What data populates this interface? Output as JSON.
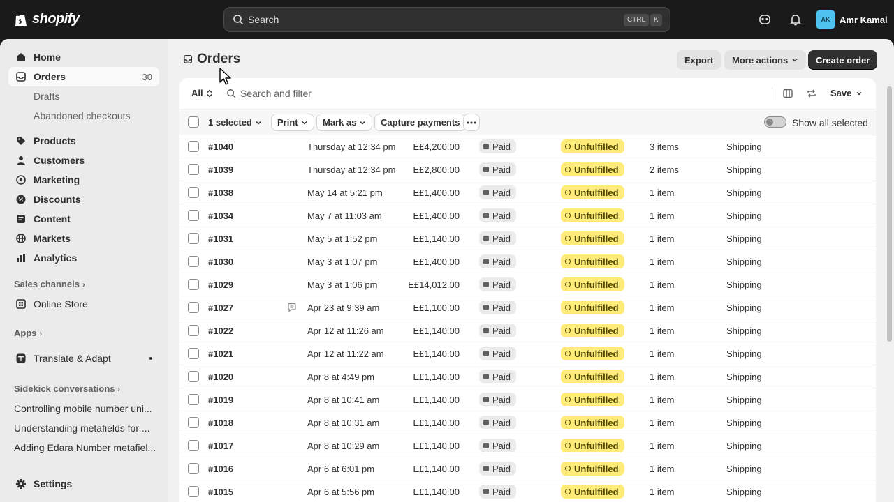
{
  "topbar": {
    "logo_text": "shopify",
    "search_placeholder": "Search",
    "shortcut_ctrl": "CTRL",
    "shortcut_key": "K",
    "user_initials": "AK",
    "user_name": "Amr Kamal",
    "avatar_color": "#4fc2f0"
  },
  "sidebar": {
    "home": "Home",
    "orders": "Orders",
    "orders_count": "30",
    "drafts": "Drafts",
    "abandoned": "Abandoned checkouts",
    "products": "Products",
    "customers": "Customers",
    "marketing": "Marketing",
    "discounts": "Discounts",
    "content": "Content",
    "markets": "Markets",
    "analytics": "Analytics",
    "sales_channels": "Sales channels",
    "online_store": "Online Store",
    "apps": "Apps",
    "translate": "Translate & Adapt",
    "sidekick": "Sidekick conversations",
    "conversations": [
      "Controlling mobile number uni...",
      "Understanding metafields for ...",
      "Adding Edara Number metafiel..."
    ],
    "settings": "Settings"
  },
  "page": {
    "title": "Orders",
    "export": "Export",
    "more_actions": "More actions",
    "create_order": "Create order"
  },
  "filters": {
    "tab_all": "All",
    "search_placeholder": "Search and filter",
    "save": "Save"
  },
  "bulk": {
    "selected": "1 selected",
    "print": "Print",
    "mark_as": "Mark as",
    "capture": "Capture payments",
    "show_all": "Show all selected"
  },
  "orders": [
    {
      "number": "#1040",
      "note": false,
      "date": "Thursday at 12:34 pm",
      "total": "E£4,200.00",
      "payment": "Paid",
      "fulfillment": "Unfulfilled",
      "items": "3 items",
      "delivery": "Shipping"
    },
    {
      "number": "#1039",
      "note": false,
      "date": "Thursday at 12:34 pm",
      "total": "E£2,800.00",
      "payment": "Paid",
      "fulfillment": "Unfulfilled",
      "items": "2 items",
      "delivery": "Shipping"
    },
    {
      "number": "#1038",
      "note": false,
      "date": "May 14 at 5:21 pm",
      "total": "E£1,400.00",
      "payment": "Paid",
      "fulfillment": "Unfulfilled",
      "items": "1 item",
      "delivery": "Shipping"
    },
    {
      "number": "#1034",
      "note": false,
      "date": "May 7 at 11:03 am",
      "total": "E£1,400.00",
      "payment": "Paid",
      "fulfillment": "Unfulfilled",
      "items": "1 item",
      "delivery": "Shipping"
    },
    {
      "number": "#1031",
      "note": false,
      "date": "May 5 at 1:52 pm",
      "total": "E£1,140.00",
      "payment": "Paid",
      "fulfillment": "Unfulfilled",
      "items": "1 item",
      "delivery": "Shipping"
    },
    {
      "number": "#1030",
      "note": false,
      "date": "May 3 at 1:07 pm",
      "total": "E£1,400.00",
      "payment": "Paid",
      "fulfillment": "Unfulfilled",
      "items": "1 item",
      "delivery": "Shipping"
    },
    {
      "number": "#1029",
      "note": false,
      "date": "May 3 at 1:06 pm",
      "total": "E£14,012.00",
      "payment": "Paid",
      "fulfillment": "Unfulfilled",
      "items": "1 item",
      "delivery": "Shipping"
    },
    {
      "number": "#1027",
      "note": true,
      "date": "Apr 23 at 9:39 am",
      "total": "E£1,100.00",
      "payment": "Paid",
      "fulfillment": "Unfulfilled",
      "items": "1 item",
      "delivery": "Shipping"
    },
    {
      "number": "#1022",
      "note": false,
      "date": "Apr 12 at 11:26 am",
      "total": "E£1,140.00",
      "payment": "Paid",
      "fulfillment": "Unfulfilled",
      "items": "1 item",
      "delivery": "Shipping"
    },
    {
      "number": "#1021",
      "note": false,
      "date": "Apr 12 at 11:22 am",
      "total": "E£1,140.00",
      "payment": "Paid",
      "fulfillment": "Unfulfilled",
      "items": "1 item",
      "delivery": "Shipping"
    },
    {
      "number": "#1020",
      "note": false,
      "date": "Apr 8 at 4:49 pm",
      "total": "E£1,140.00",
      "payment": "Paid",
      "fulfillment": "Unfulfilled",
      "items": "1 item",
      "delivery": "Shipping"
    },
    {
      "number": "#1019",
      "note": false,
      "date": "Apr 8 at 10:41 am",
      "total": "E£1,140.00",
      "payment": "Paid",
      "fulfillment": "Unfulfilled",
      "items": "1 item",
      "delivery": "Shipping"
    },
    {
      "number": "#1018",
      "note": false,
      "date": "Apr 8 at 10:31 am",
      "total": "E£1,140.00",
      "payment": "Paid",
      "fulfillment": "Unfulfilled",
      "items": "1 item",
      "delivery": "Shipping"
    },
    {
      "number": "#1017",
      "note": false,
      "date": "Apr 8 at 10:29 am",
      "total": "E£1,140.00",
      "payment": "Paid",
      "fulfillment": "Unfulfilled",
      "items": "1 item",
      "delivery": "Shipping"
    },
    {
      "number": "#1016",
      "note": false,
      "date": "Apr 6 at 6:01 pm",
      "total": "E£1,140.00",
      "payment": "Paid",
      "fulfillment": "Unfulfilled",
      "items": "1 item",
      "delivery": "Shipping"
    },
    {
      "number": "#1015",
      "note": false,
      "date": "Apr 6 at 5:56 pm",
      "total": "E£1,140.00",
      "payment": "Paid",
      "fulfillment": "Unfulfilled",
      "items": "1 item",
      "delivery": "Shipping"
    }
  ],
  "colors": {
    "topbar_bg": "#1a1a1a",
    "unfulfilled_badge": "#ffeb78",
    "paid_badge": "#ebebeb",
    "primary_button": "#303030"
  }
}
